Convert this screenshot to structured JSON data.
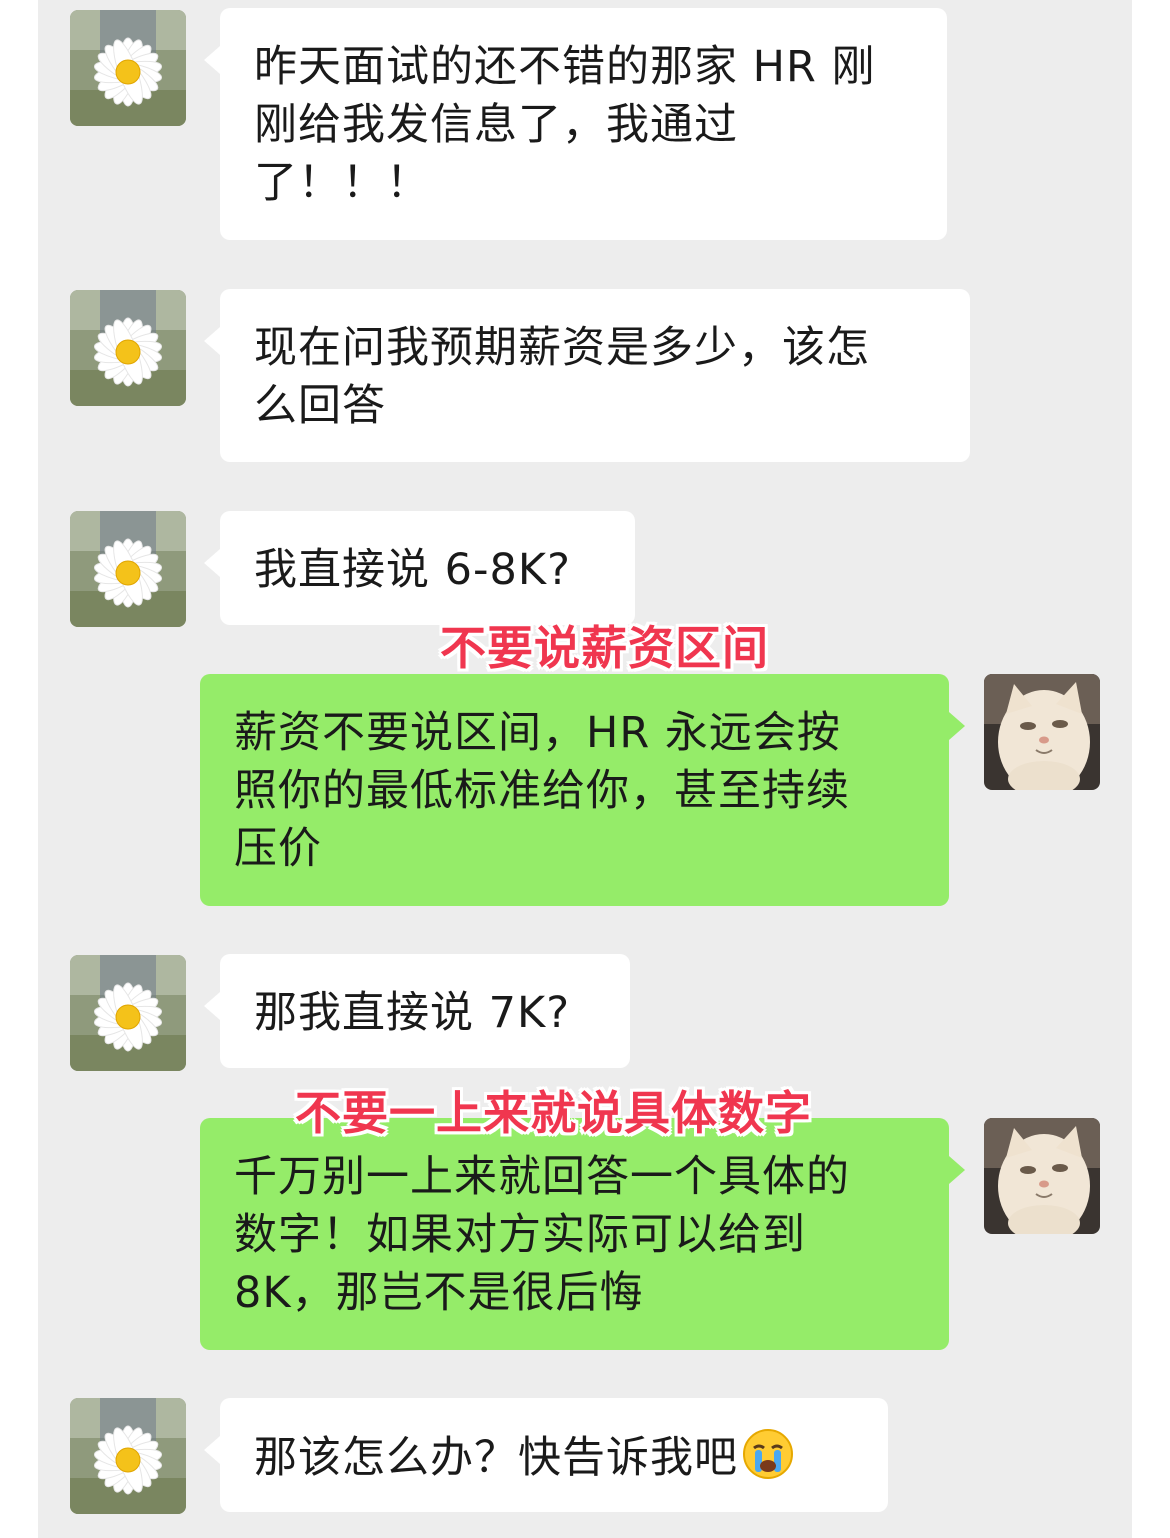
{
  "messages": [
    {
      "side": "in",
      "text": "昨天面试的还不错的那家HR刚刚给我发信息了，我通过了！！！",
      "lines": [
        "昨天面试的还不错的那家 HR 刚",
        "刚给我发信息了，我通过",
        "了！！！"
      ]
    },
    {
      "side": "in",
      "lines": [
        "现在问我预期薪资是多少，该怎",
        "么回答"
      ]
    },
    {
      "side": "in",
      "lines": [
        "我直接说 6-8K?"
      ]
    },
    {
      "side": "out",
      "lines": [
        "薪资不要说区间，HR 永远会按",
        "照你的最低标准给你，甚至持续",
        "压价"
      ]
    },
    {
      "side": "in",
      "lines": [
        "那我直接说 7K?"
      ]
    },
    {
      "side": "out",
      "lines": [
        "千万别一上来就回答一个具体的",
        "数字！如果对方实际可以给到",
        "8K，那岂不是很后悔"
      ]
    },
    {
      "side": "in",
      "lines": [
        "那该怎么办？快告诉我吧"
      ],
      "emoji": "loudly-crying-face-icon"
    }
  ],
  "annotations": [
    {
      "text": "不要说薪资区间"
    },
    {
      "text": "不要一上来就说具体数字"
    }
  ],
  "avatars": {
    "friend": "daisy-avatar",
    "me": "cat-avatar"
  },
  "colors": {
    "chat_background": "#ededed",
    "incoming_bubble": "#ffffff",
    "outgoing_bubble": "#95ec69",
    "annotation": "#f0364f"
  }
}
